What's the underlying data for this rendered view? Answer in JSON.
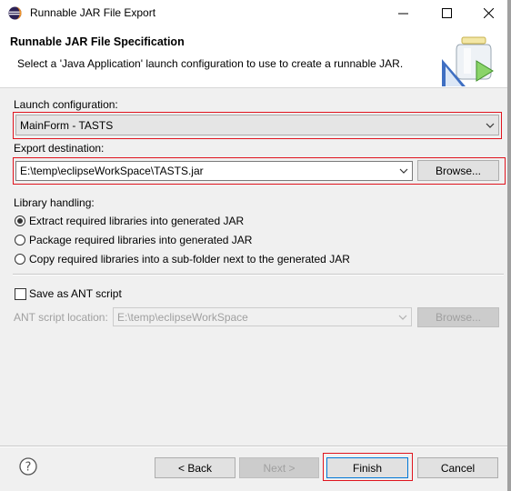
{
  "window": {
    "title": "Runnable JAR File Export",
    "icon": "eclipse-icon"
  },
  "banner": {
    "title": "Runnable JAR File Specification",
    "description": "Select a 'Java Application' launch configuration to use to create a runnable JAR.",
    "image": "jar-wizard-banner"
  },
  "launch": {
    "label": "Launch configuration:",
    "value": "MainForm - TASTS"
  },
  "export": {
    "label": "Export destination:",
    "value": "E:\\temp\\eclipseWorkSpace\\TASTS.jar",
    "browse_label": "Browse..."
  },
  "library": {
    "label": "Library handling:",
    "options": [
      {
        "label": "Extract required libraries into generated JAR",
        "selected": true
      },
      {
        "label": "Package required libraries into generated JAR",
        "selected": false
      },
      {
        "label": "Copy required libraries into a sub-folder next to the generated JAR",
        "selected": false
      }
    ]
  },
  "ant": {
    "checkbox_label": "Save as ANT script",
    "checked": false,
    "location_label": "ANT script location:",
    "location_value": "E:\\temp\\eclipseWorkSpace",
    "browse_label": "Browse..."
  },
  "footer": {
    "help_icon": "help-icon",
    "back_label": "< Back",
    "next_label": "Next >",
    "finish_label": "Finish",
    "cancel_label": "Cancel"
  },
  "colors": {
    "highlight": "#e0141e",
    "panel_bg": "#f0f0f0",
    "primary_border": "#0078d7"
  }
}
